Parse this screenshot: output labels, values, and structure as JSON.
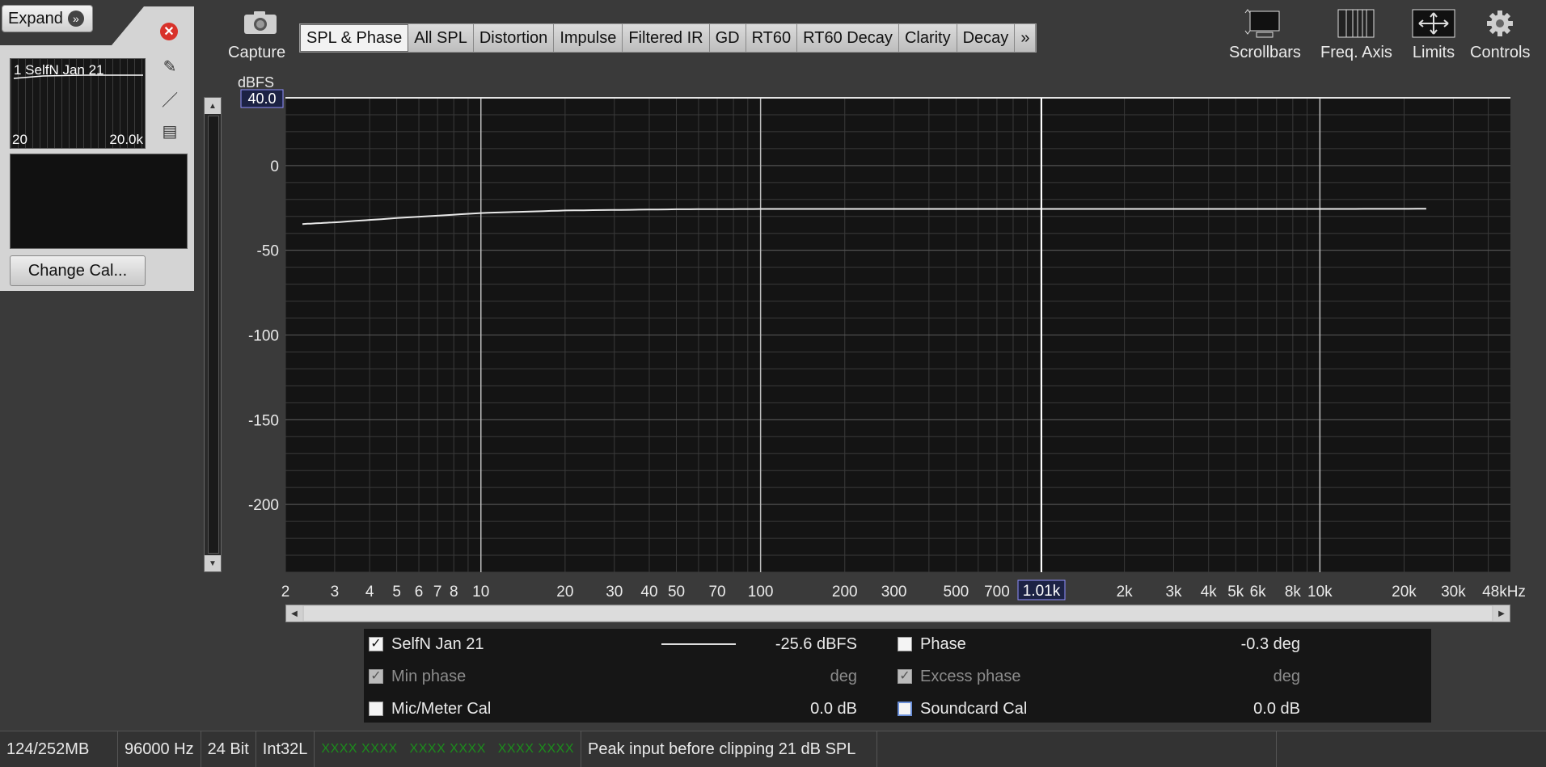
{
  "left_panel": {
    "expand_label": "Expand",
    "measurement_name": "1 SelfN Jan 21",
    "thumb_lo": "20",
    "thumb_hi": "20.0k",
    "change_cal_label": "Change Cal..."
  },
  "capture_label": "Capture",
  "tabs": [
    {
      "label": "SPL & Phase",
      "active": true
    },
    {
      "label": "All SPL"
    },
    {
      "label": "Distortion"
    },
    {
      "label": "Impulse"
    },
    {
      "label": "Filtered IR"
    },
    {
      "label": "GD"
    },
    {
      "label": "RT60"
    },
    {
      "label": "RT60 Decay"
    },
    {
      "label": "Clarity"
    },
    {
      "label": "Decay"
    },
    {
      "label": "»"
    }
  ],
  "toolbar": {
    "scrollbars": "Scrollbars",
    "freq_axis": "Freq. Axis",
    "limits": "Limits",
    "controls": "Controls"
  },
  "chart_data": {
    "type": "line",
    "ylabel": "dBFS",
    "y_top_readout": "40.0",
    "x_cursor_readout": "1.01k",
    "cursor_x_hz": 1010,
    "x_scale": "log",
    "xlim": [
      2,
      48000
    ],
    "ylim": [
      -240,
      40
    ],
    "y_ticks": [
      0,
      -50,
      -100,
      -150,
      -200
    ],
    "x_ticks": [
      {
        "v": 2,
        "l": "2"
      },
      {
        "v": 3,
        "l": "3"
      },
      {
        "v": 4,
        "l": "4"
      },
      {
        "v": 5,
        "l": "5"
      },
      {
        "v": 6,
        "l": "6"
      },
      {
        "v": 7,
        "l": "7"
      },
      {
        "v": 8,
        "l": "8"
      },
      {
        "v": 10,
        "l": "10"
      },
      {
        "v": 20,
        "l": "20"
      },
      {
        "v": 30,
        "l": "30"
      },
      {
        "v": 40,
        "l": "40"
      },
      {
        "v": 50,
        "l": "50"
      },
      {
        "v": 70,
        "l": "70"
      },
      {
        "v": 100,
        "l": "100"
      },
      {
        "v": 200,
        "l": "200"
      },
      {
        "v": 300,
        "l": "300"
      },
      {
        "v": 500,
        "l": "500"
      },
      {
        "v": 700,
        "l": "700"
      },
      {
        "v": 2000,
        "l": "2k"
      },
      {
        "v": 3000,
        "l": "3k"
      },
      {
        "v": 4000,
        "l": "4k"
      },
      {
        "v": 5000,
        "l": "5k"
      },
      {
        "v": 6000,
        "l": "6k"
      },
      {
        "v": 8000,
        "l": "8k"
      },
      {
        "v": 10000,
        "l": "10k"
      },
      {
        "v": 20000,
        "l": "20k"
      },
      {
        "v": 30000,
        "l": "30k"
      },
      {
        "v": 48000,
        "l": "48kHz"
      }
    ],
    "series": [
      {
        "name": "SelfN Jan 21",
        "x": [
          2.3,
          3,
          5,
          10,
          20,
          50,
          100,
          1000,
          10000,
          24000
        ],
        "y": [
          -34.5,
          -33.5,
          -31,
          -28,
          -26.5,
          -25.8,
          -25.6,
          -25.6,
          -25.6,
          -25.5
        ]
      }
    ]
  },
  "legend": {
    "row1": {
      "name": "SelfN Jan 21",
      "value": "-25.6 dBFS",
      "right_name": "Phase",
      "right_value": "-0.3 deg"
    },
    "row2": {
      "name": "Min phase",
      "value": "deg",
      "right_name": "Excess phase",
      "right_value": "deg"
    },
    "row3": {
      "name": "Mic/Meter Cal",
      "value": "0.0 dB",
      "right_name": "Soundcard Cal",
      "right_value": "0.0 dB"
    }
  },
  "status": {
    "memory": "124/252MB",
    "rate": "96000 Hz",
    "bits": "24 Bit",
    "format": "Int32L",
    "meters": "XXXX XXXX   XXXX XXXX   XXXX XXXX",
    "message": "Peak input before clipping 21 dB SPL"
  }
}
